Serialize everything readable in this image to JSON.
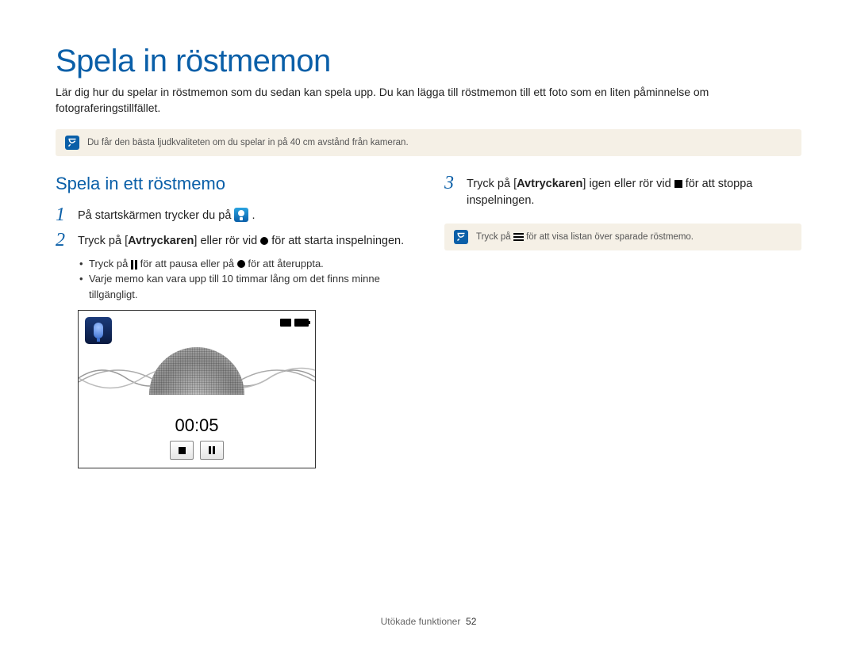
{
  "title": "Spela in röstmemon",
  "intro": "Lär dig hur du spelar in röstmemon som du sedan kan spela upp. Du kan lägga till röstmemon till ett foto som en liten påminnelse om fotograferingstillfället.",
  "note_top": "Du får den bästa ljudkvaliteten om du spelar in på 40 cm avstånd från kameran.",
  "section_title": "Spela in ett röstmemo",
  "step1": "På startskärmen trycker du på",
  "step2_a": "Tryck på [",
  "step2_bold": "Avtryckaren",
  "step2_b": "] eller rör vid",
  "step2_c": "för att starta inspelningen.",
  "sub1_a": "Tryck på",
  "sub1_b": "för att pausa eller på",
  "sub1_c": "för att återuppta.",
  "sub2": "Varje memo kan vara upp till 10 timmar lång om det finns minne tillgängligt.",
  "timer": "00:05",
  "step3_a": "Tryck på [",
  "step3_bold": "Avtryckaren",
  "step3_b": "] igen eller rör vid",
  "step3_c": "för att stoppa inspelningen.",
  "note_right_a": "Tryck på",
  "note_right_b": "för att visa listan över sparade röstmemo.",
  "footer_section": "Utökade funktioner",
  "footer_page": "52"
}
